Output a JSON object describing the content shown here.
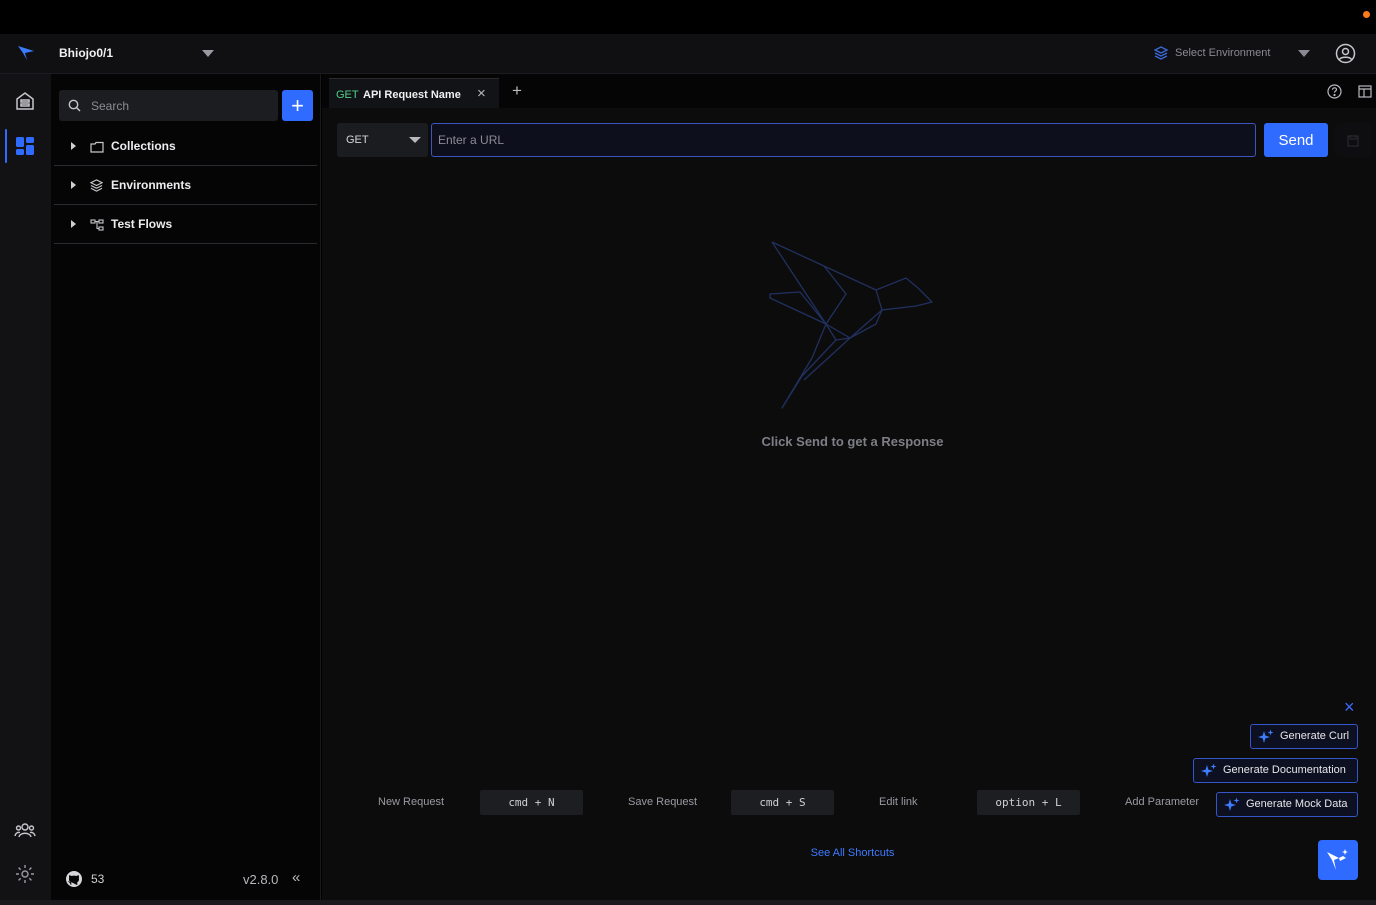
{
  "topbar": {
    "workspace_name": "Bhiojo0/1",
    "environment_label": "Select Environment"
  },
  "sidebar": {
    "search_placeholder": "Search",
    "add_label": "+",
    "items": [
      {
        "label": "Collections",
        "icon": "folder-icon"
      },
      {
        "label": "Environments",
        "icon": "layers-icon"
      },
      {
        "label": "Test Flows",
        "icon": "flow-icon"
      }
    ],
    "github_stars": "53",
    "version": "v2.8.0",
    "collapse_label": "«"
  },
  "tabs": [
    {
      "method": "GET",
      "title": "API Request Name",
      "close": "×"
    }
  ],
  "new_tab_label": "+",
  "request": {
    "method": "GET",
    "url_placeholder": "Enter a URL",
    "url_value": "",
    "send_label": "Send"
  },
  "response": {
    "empty_text": "Click Send to get a Response"
  },
  "ai_actions": {
    "dismiss": "×",
    "generate_curl": "Generate Curl",
    "generate_documentation": "Generate Documentation",
    "generate_mock_data": "Generate Mock Data"
  },
  "shortcuts": [
    {
      "label": "New Request",
      "keys": "cmd + N"
    },
    {
      "label": "Save Request",
      "keys": "cmd + S"
    },
    {
      "label": "Edit link",
      "keys": "option + L"
    },
    {
      "label": "Add Parameter",
      "keys": ""
    }
  ],
  "see_all_shortcuts": "See All Shortcuts",
  "colors": {
    "accent": "#2f6bff",
    "method_get": "#4fd08a",
    "background": "#0c0c0d",
    "notification": "#ff7a1a"
  }
}
